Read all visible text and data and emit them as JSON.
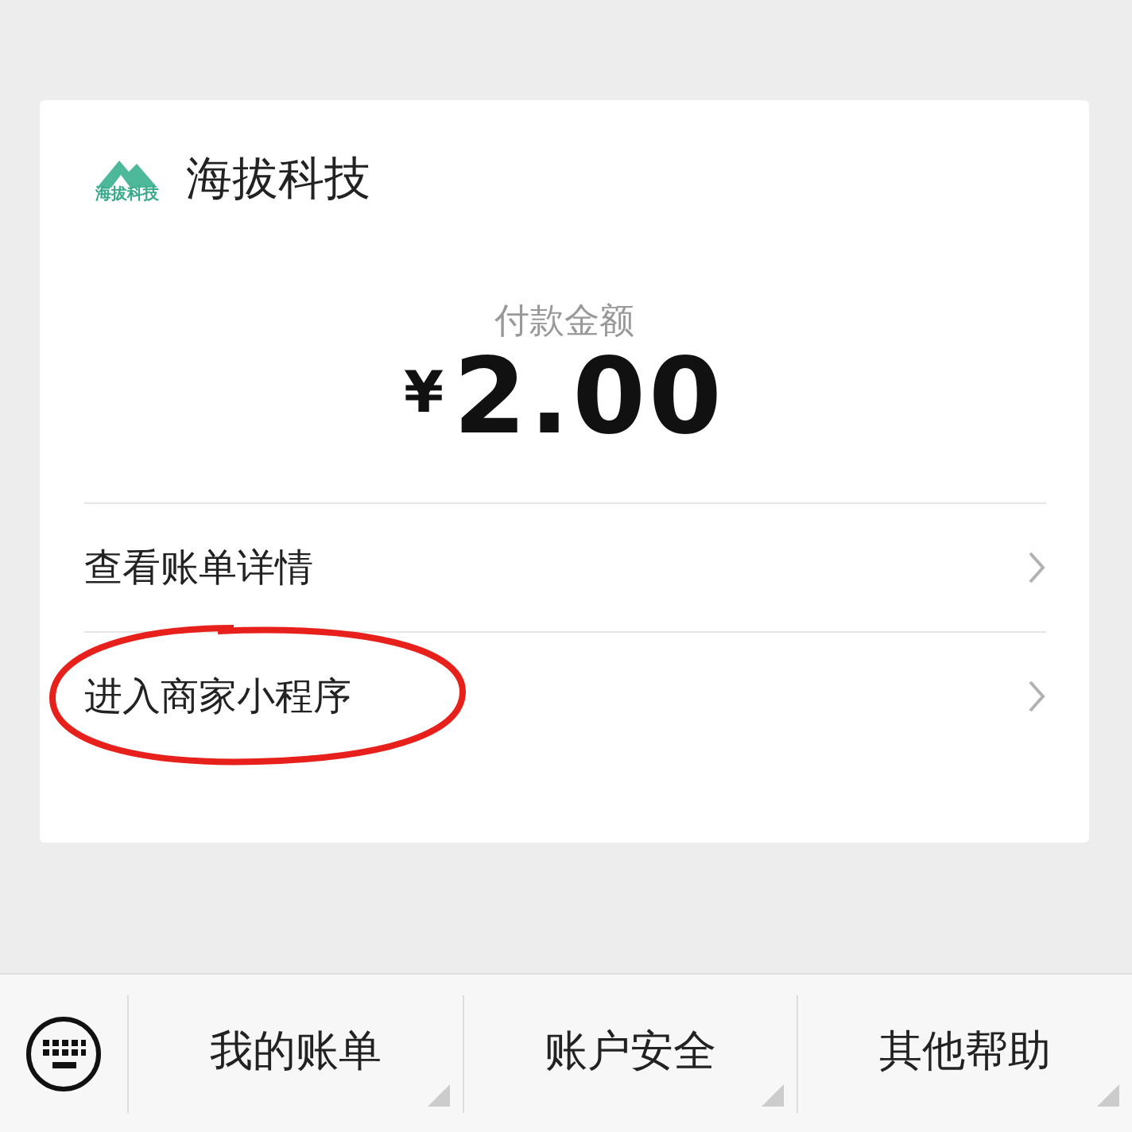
{
  "merchant": {
    "logo_text": "海拔科技",
    "name": "海拔科技"
  },
  "payment": {
    "label": "付款金额",
    "currency": "¥",
    "amount": "2.00"
  },
  "actions": [
    {
      "label": "查看账单详情",
      "circled": false
    },
    {
      "label": "进入商家小程序",
      "circled": true
    }
  ],
  "menu": {
    "keyboard": true,
    "items": [
      "我的账单",
      "账户安全",
      "其他帮助"
    ]
  }
}
